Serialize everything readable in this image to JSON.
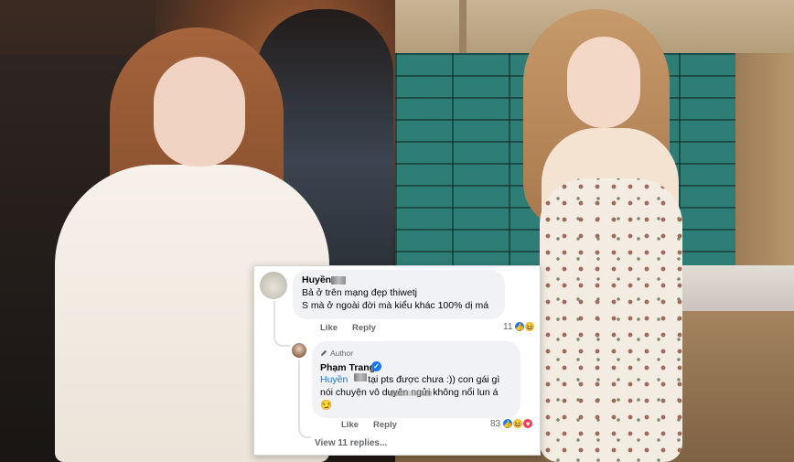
{
  "comments": {
    "first": {
      "author": "Huyền",
      "line1": "Bả ở trên mạng đẹp thiwetj",
      "line2": "S mà ở ngoài đời mà kiểu khác 100% dị má",
      "like_label": "Like",
      "reply_label": "Reply",
      "reaction_count": "11"
    },
    "reply": {
      "badge": "Author",
      "author": "Phạm Trang",
      "mention": "Huyền",
      "line1_rest": "tại pts được chưa :)) con gái gì",
      "line2": "nói chuyện vô duyên ngửi không nổi lun á",
      "line3": "😏",
      "like_label": "Like",
      "reply_label": "Reply",
      "reaction_count": "83"
    },
    "view_replies": "View 11 replies..."
  },
  "icons": {
    "verified": "verified-badge-icon",
    "author_badge": "pen-icon",
    "reactions": [
      "like-icon",
      "haha-icon",
      "love-icon"
    ]
  },
  "colors": {
    "facebook_blue": "#1877f2",
    "bubble_bg": "#f0f2f5",
    "secondary_text": "#65676b"
  }
}
